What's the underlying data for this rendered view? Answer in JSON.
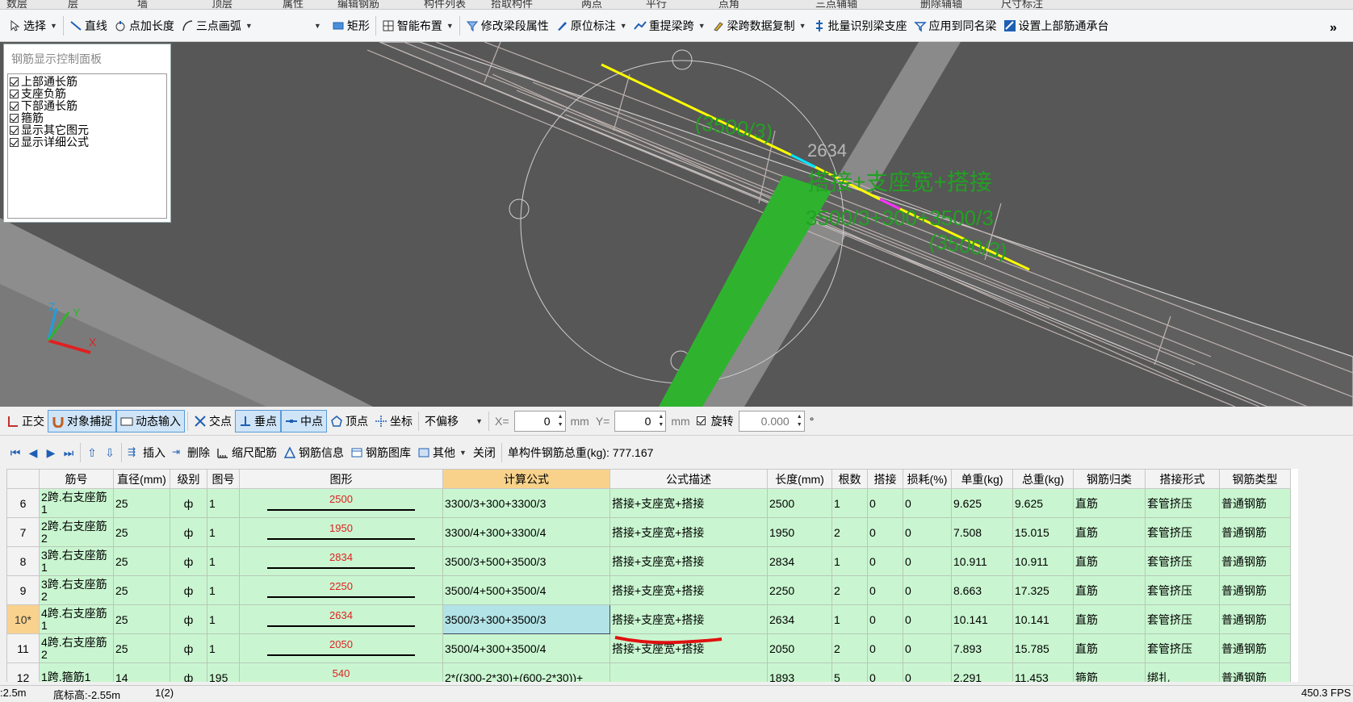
{
  "top_strip": [
    "数层",
    "层",
    "墙",
    "顶层",
    "属性",
    "编辑钢筋",
    "构件列表",
    "拾取构件",
    "两点",
    "平行",
    "点角",
    "三点辅轴",
    "删除辅轴",
    "尺寸标注"
  ],
  "toolbar": {
    "select_label": "选择",
    "line_label": "直线",
    "point_len_label": "点加长度",
    "arc_label": "三点画弧",
    "rect_label": "矩形",
    "smart_label": "智能布置",
    "modify_label": "修改梁段属性",
    "origin_label": "原位标注",
    "extract_label": "重提梁跨",
    "copy_label": "梁跨数据复制",
    "batch_label": "批量识别梁支座",
    "apply_label": "应用到同名梁",
    "setup_label": "设置上部筋通承台",
    "more_label": "»"
  },
  "panel": {
    "title": "钢筋显示控制面板",
    "items": [
      "上部通长筋",
      "支座负筋",
      "下部通长筋",
      "箍筋",
      "显示其它图元",
      "显示详细公式"
    ]
  },
  "viewport": {
    "labels": {
      "a": "(3500/3)",
      "b": "2634",
      "c": "搭接+支座宽+搭接",
      "d": "3500/3+300+3500/3",
      "e": "(3500/3)"
    },
    "axes": {
      "z": "Z",
      "y": "Y",
      "x": "X"
    }
  },
  "snapbar": {
    "ortho": "正交",
    "obj_snap": "对象捕捉",
    "dyn_input": "动态输入",
    "intersect": "交点",
    "perp": "垂点",
    "mid": "中点",
    "vertex": "顶点",
    "coord": "坐标",
    "offset": "不偏移",
    "x_label": "X=",
    "x_val": "0",
    "unit1": "mm",
    "y_label": "Y=",
    "y_val": "0",
    "unit2": "mm",
    "rotate": "旋转",
    "rot_val": "0.000",
    "deg": "°"
  },
  "rebarbar": {
    "insert": "插入",
    "delete": "删除",
    "scale": "缩尺配筋",
    "info": "钢筋信息",
    "lib": "钢筋图库",
    "other": "其他",
    "close": "关闭",
    "total": "单构件钢筋总重(kg): 777.167"
  },
  "grid": {
    "headers": [
      "",
      "筋号",
      "直径(mm)",
      "级别",
      "图号",
      "图形",
      "计算公式",
      "公式描述",
      "长度(mm)",
      "根数",
      "搭接",
      "损耗(%)",
      "单重(kg)",
      "总重(kg)",
      "钢筋归类",
      "搭接形式",
      "钢筋类型"
    ],
    "rows": [
      {
        "rn": "6",
        "name": "2跨.右支座筋1",
        "dia": "25",
        "grade": "ф",
        "fig": "1",
        "shape": "2500",
        "formula": "3300/3+300+3300/3",
        "desc": "搭接+支座宽+搭接",
        "len": "2500",
        "count": "1",
        "lap": "0",
        "loss": "0",
        "unit": "9.625",
        "total": "9.625",
        "cls": "直筋",
        "lapform": "套管挤压",
        "type": "普通钢筋"
      },
      {
        "rn": "7",
        "name": "2跨.右支座筋2",
        "dia": "25",
        "grade": "ф",
        "fig": "1",
        "shape": "1950",
        "formula": "3300/4+300+3300/4",
        "desc": "搭接+支座宽+搭接",
        "len": "1950",
        "count": "2",
        "lap": "0",
        "loss": "0",
        "unit": "7.508",
        "total": "15.015",
        "cls": "直筋",
        "lapform": "套管挤压",
        "type": "普通钢筋"
      },
      {
        "rn": "8",
        "name": "3跨.右支座筋1",
        "dia": "25",
        "grade": "ф",
        "fig": "1",
        "shape": "2834",
        "formula": "3500/3+500+3500/3",
        "desc": "搭接+支座宽+搭接",
        "len": "2834",
        "count": "1",
        "lap": "0",
        "loss": "0",
        "unit": "10.911",
        "total": "10.911",
        "cls": "直筋",
        "lapform": "套管挤压",
        "type": "普通钢筋"
      },
      {
        "rn": "9",
        "name": "3跨.右支座筋2",
        "dia": "25",
        "grade": "ф",
        "fig": "1",
        "shape": "2250",
        "formula": "3500/4+500+3500/4",
        "desc": "搭接+支座宽+搭接",
        "len": "2250",
        "count": "2",
        "lap": "0",
        "loss": "0",
        "unit": "8.663",
        "total": "17.325",
        "cls": "直筋",
        "lapform": "套管挤压",
        "type": "普通钢筋"
      },
      {
        "rn": "10*",
        "name": "4跨.右支座筋1",
        "dia": "25",
        "grade": "ф",
        "fig": "1",
        "shape": "2634",
        "formula": "3500/3+300+3500/3",
        "desc": "搭接+支座宽+搭接",
        "len": "2634",
        "count": "1",
        "lap": "0",
        "loss": "0",
        "unit": "10.141",
        "total": "10.141",
        "cls": "直筋",
        "lapform": "套管挤压",
        "type": "普通钢筋",
        "current": true
      },
      {
        "rn": "11",
        "name": "4跨.右支座筋2",
        "dia": "25",
        "grade": "ф",
        "fig": "1",
        "shape": "2050",
        "formula": "3500/4+300+3500/4",
        "desc": "搭接+支座宽+搭接",
        "len": "2050",
        "count": "2",
        "lap": "0",
        "loss": "0",
        "unit": "7.893",
        "total": "15.785",
        "cls": "直筋",
        "lapform": "套管挤压",
        "type": "普通钢筋"
      },
      {
        "rn": "12",
        "name": "1跨.箍筋1",
        "dia": "14",
        "grade": "ф",
        "fig": "195",
        "shape": "540",
        "formula": "2*((300-2*30)+(600-2*30))+",
        "desc": "",
        "len": "1893",
        "count": "5",
        "lap": "0",
        "loss": "0",
        "unit": "2.291",
        "total": "11.453",
        "cls": "箍筋",
        "lapform": "绑扎",
        "type": "普通钢筋"
      }
    ]
  },
  "status": {
    "a": ":2.5m",
    "b": "底标高:-2.55m",
    "c": "1(2)",
    "d": "450.3 FPS"
  },
  "colors": {
    "viewport_bg": "#575757",
    "row_bg": "#c9f6d0",
    "current_row": "#f9d28e",
    "annot_green": "#22a022",
    "highlight_yellow": "#ffff00"
  }
}
